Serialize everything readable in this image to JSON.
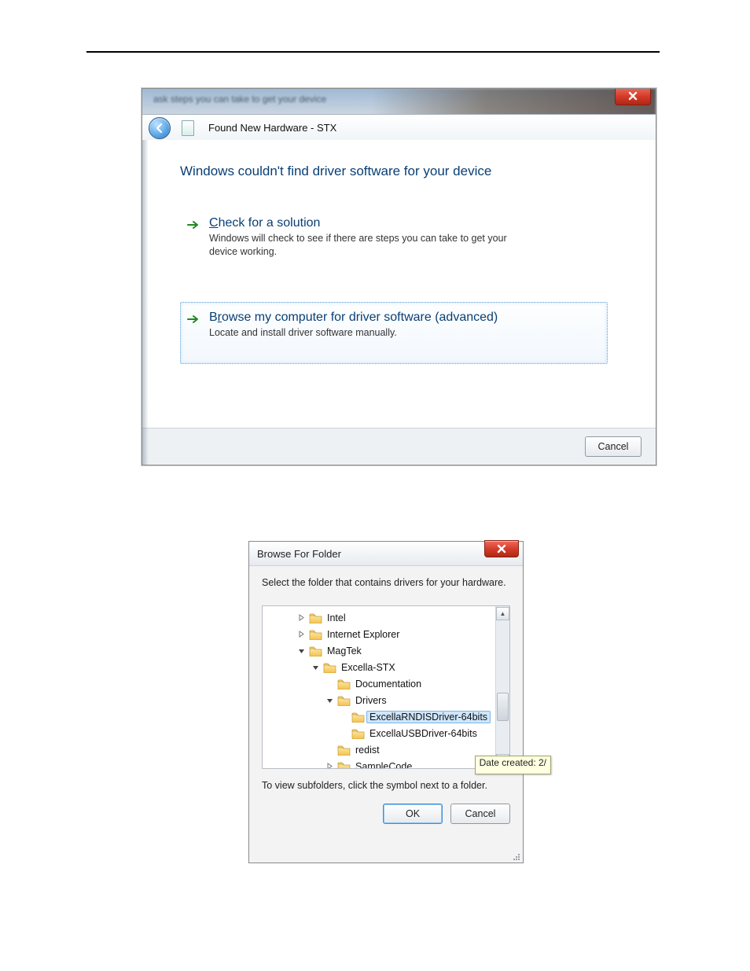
{
  "wizard": {
    "glass_blur_text": "ask steps you can take to get your device",
    "nav_title": "Found New Hardware - STX",
    "heading": "Windows couldn't find driver software for your device",
    "option1": {
      "title": "Check for a solution",
      "accel_char": "C",
      "desc": "Windows will check to see if there are steps you can take to get your device working."
    },
    "option2": {
      "title": "Browse my computer for driver software (advanced)",
      "accel_char": "r",
      "desc": "Locate and install driver software manually."
    },
    "cancel": "Cancel"
  },
  "browse": {
    "title": "Browse For Folder",
    "instruction": "Select the folder that contains drivers for your hardware.",
    "tree": [
      {
        "indent": 0,
        "exp": "closed",
        "label": "Intel"
      },
      {
        "indent": 0,
        "exp": "closed",
        "label": "Internet Explorer"
      },
      {
        "indent": 0,
        "exp": "open",
        "label": "MagTek"
      },
      {
        "indent": 1,
        "exp": "open",
        "label": "Excella-STX"
      },
      {
        "indent": 2,
        "exp": "none",
        "label": "Documentation"
      },
      {
        "indent": 2,
        "exp": "open",
        "label": "Drivers"
      },
      {
        "indent": 3,
        "exp": "none",
        "label": "ExcellaRNDISDriver-64bits",
        "selected": true
      },
      {
        "indent": 3,
        "exp": "none",
        "label": "ExcellaUSBDriver-64bits"
      },
      {
        "indent": 2,
        "exp": "none",
        "label": "redist"
      },
      {
        "indent": 2,
        "exp": "closed",
        "label": "SampleCode"
      }
    ],
    "tooltip": "Date created: 2/",
    "hint": "To view subfolders, click the symbol next to a folder.",
    "ok": "OK",
    "cancel": "Cancel"
  }
}
